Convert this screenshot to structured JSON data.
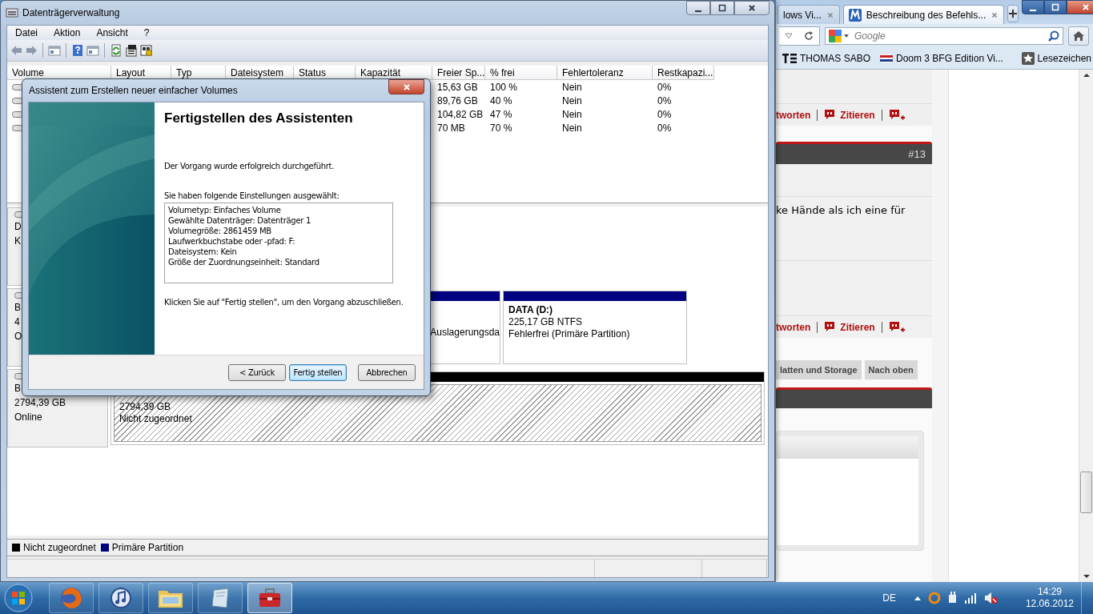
{
  "browser": {
    "tabs": [
      {
        "label": "lows Vi...",
        "selected": false
      },
      {
        "label": "Beschreibung des Befehls...",
        "selected": true
      }
    ],
    "search": {
      "placeholder": "Google"
    },
    "bookmarks": [
      {
        "kind": "logo",
        "label": "THOMAS SABO"
      },
      {
        "kind": "flag",
        "label": "Doom 3 BFG Edition Vi..."
      }
    ],
    "bookmarks_menu": "Lesezeichen",
    "post_actions": [
      "tworten",
      "Zitieren"
    ],
    "post_actions_2": [
      "tworten",
      "Zitieren"
    ],
    "post_number": "#13",
    "post_text": "ke Hände als ich eine für",
    "nav_buttons": [
      "latten und Storage",
      "Nach oben"
    ]
  },
  "disk_management": {
    "title": "Datenträgerverwaltung",
    "menu": [
      "Datei",
      "Aktion",
      "Ansicht",
      "?"
    ],
    "volume_table": {
      "columns": [
        "Volume",
        "Layout",
        "Typ",
        "Dateisystem",
        "Status",
        "Kapazität",
        "Freier Sp...",
        "% frei",
        "Fehlertoleranz",
        "Restkapazi..."
      ],
      "rows": [
        {
          "visible_cells": [
            "15,63 GB",
            "100 %",
            "Nein",
            "0%"
          ]
        },
        {
          "visible_cells": [
            "89,76 GB",
            "40 %",
            "Nein",
            "0%"
          ]
        },
        {
          "visible_cells": [
            "104,82 GB",
            "47 %",
            "Nein",
            "0%"
          ]
        },
        {
          "visible_cells": [
            "70 MB",
            "70 %",
            "Nein",
            "0%"
          ]
        }
      ]
    },
    "disks": [
      {
        "labels": [
          "D",
          "K"
        ]
      },
      {
        "labels": [
          "B",
          "4",
          "O"
        ],
        "partitions": [
          {
            "kind": "primary",
            "lines": [
              "Auslagerungsda"
            ]
          },
          {
            "kind": "primary",
            "name": "DATA  (D:)",
            "lines": [
              "225,17 GB NTFS",
              "Fehlerfrei (Primäre Partition)"
            ]
          }
        ]
      },
      {
        "labels": [
          "B",
          "2794,39 GB",
          "Online"
        ],
        "partitions": [
          {
            "kind": "unallocated",
            "lines": [
              "2794,39 GB",
              "Nicht zugeordnet"
            ]
          }
        ]
      }
    ],
    "legend": [
      {
        "label": "Nicht zugeordnet",
        "color": "#000000"
      },
      {
        "label": "Primäre Partition",
        "color": "#000080"
      }
    ]
  },
  "wizard": {
    "title": "Assistent zum Erstellen neuer einfacher Volumes",
    "heading": "Fertigstellen des Assistenten",
    "message": "Der Vorgang wurde erfolgreich durchgeführt.",
    "settings_label": "Sie haben folgende Einstellungen ausgewählt:",
    "settings": [
      "Volumetyp: Einfaches Volume",
      "Gewählte Datenträger: Datenträger 1",
      "Volumegröße: 2861459 MB",
      "Laufwerkbuchstabe oder -pfad: F:",
      "Dateisystem: Kein",
      "Größe der Zuordnungseinheit: Standard"
    ],
    "hint": "Klicken Sie auf \"Fertig stellen\", um den Vorgang abzuschließen.",
    "buttons": [
      {
        "label": "< Zurück",
        "default": false
      },
      {
        "label": "Fertig stellen",
        "default": true
      },
      {
        "label": "Abbrechen",
        "default": false
      }
    ]
  },
  "taskbar": {
    "apps": [
      {
        "kind": "firefox",
        "selected": false
      },
      {
        "kind": "music",
        "selected": false
      },
      {
        "kind": "folder",
        "selected": false
      },
      {
        "kind": "notepad",
        "selected": false
      },
      {
        "kind": "toolbox",
        "selected": true
      }
    ],
    "language": "DE",
    "time": "14:29",
    "date": "12.06.2012"
  }
}
